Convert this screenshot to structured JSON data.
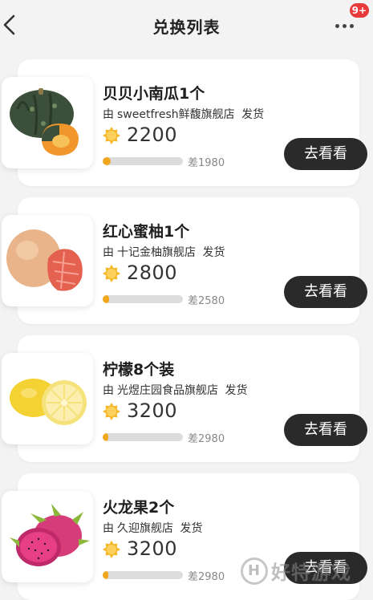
{
  "header": {
    "title": "兑换列表",
    "badge": "9+"
  },
  "items": [
    {
      "name": "贝贝小南瓜1个",
      "by": "由",
      "shop": "sweetfresh鲜馥旗舰店",
      "ship": "发货",
      "price": "2200",
      "diff": "差1980",
      "progress": 0.1,
      "button": "去看看",
      "icon": "pumpkin-image"
    },
    {
      "name": "红心蜜柚1个",
      "by": "由",
      "shop": "十记金柚旗舰店",
      "ship": "发货",
      "price": "2800",
      "diff": "差2580",
      "progress": 0.08,
      "button": "去看看",
      "icon": "pomelo-image"
    },
    {
      "name": "柠檬8个装",
      "by": "由",
      "shop": "光煜庄园食品旗舰店",
      "ship": "发货",
      "price": "3200",
      "diff": "差2980",
      "progress": 0.07,
      "button": "去看看",
      "icon": "lemon-image"
    },
    {
      "name": "火龙果2个",
      "by": "由",
      "shop": "久迎旗舰店",
      "ship": "发货",
      "price": "3200",
      "diff": "差2980",
      "progress": 0.07,
      "button": "去看看",
      "icon": "dragon-fruit-image"
    }
  ],
  "watermark": {
    "logo": "H",
    "text": "好特游戏"
  },
  "colors": {
    "button": "#2a2a2a",
    "progress_fill": "#f2a81d",
    "progress_track": "#dcdcdc",
    "coin": "#f5b82a",
    "badge": "#e83a3a"
  }
}
